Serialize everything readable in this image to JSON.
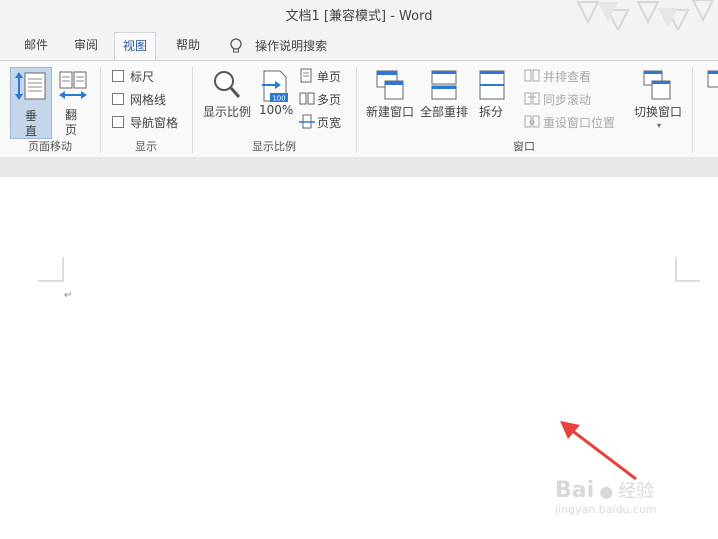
{
  "window": {
    "title": "文档1 [兼容模式]  -  Word"
  },
  "tabs": [
    {
      "label": "邮件"
    },
    {
      "label": "审阅"
    },
    {
      "label": "视图"
    },
    {
      "label": "帮助"
    }
  ],
  "tell_me": {
    "label": "操作说明搜索"
  },
  "ribbon": {
    "page_movement": {
      "vertical_line1": "垂",
      "vertical_line2": "直",
      "side_line1": "翻",
      "side_line2": "页",
      "group_label": "页面移动"
    },
    "show": {
      "ruler": "标尺",
      "gridlines": "网格线",
      "nav_pane": "导航窗格",
      "group_label": "显示"
    },
    "zoom": {
      "zoom": "显示比例",
      "hundred": "100%",
      "hundred_icon_text": "100",
      "one_page": "单页",
      "multi_page": "多页",
      "page_width": "页宽",
      "group_label": "显示比例"
    },
    "window": {
      "new_window": "新建窗口",
      "arrange_all": "全部重排",
      "split": "拆分",
      "side_by_side": "并排查看",
      "sync_scroll": "同步滚动",
      "reset_position": "重设窗口位置",
      "switch_window": "切换窗口",
      "group_label": "窗口"
    }
  },
  "watermark": {
    "brand": "Bai",
    "brand2": "经验",
    "url": "jingyan.baidu.com"
  },
  "colors": {
    "accent": "#2b579a",
    "arrow": "#e8413c"
  }
}
